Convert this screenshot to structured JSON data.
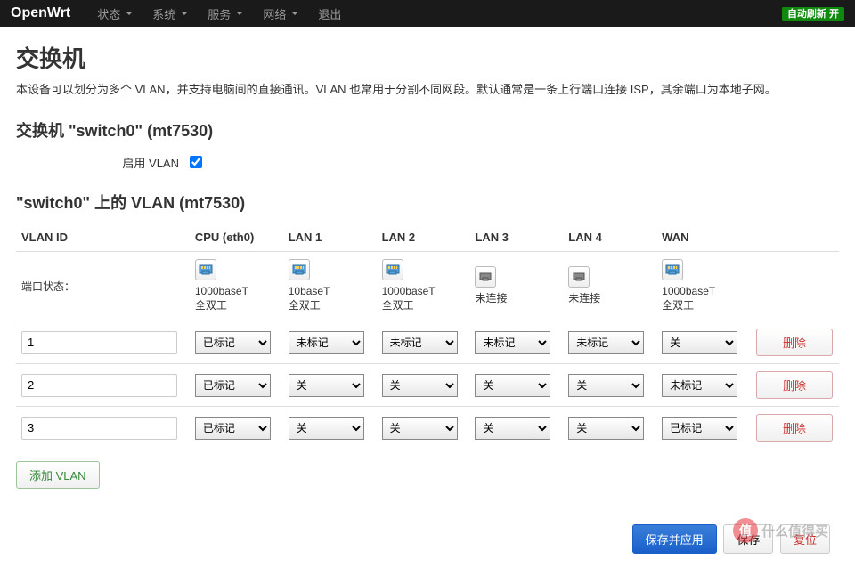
{
  "navbar": {
    "brand": "OpenWrt",
    "items": [
      {
        "label": "状态",
        "caret": true
      },
      {
        "label": "系统",
        "caret": true
      },
      {
        "label": "服务",
        "caret": true
      },
      {
        "label": "网络",
        "caret": true
      },
      {
        "label": "退出",
        "caret": false
      }
    ],
    "auto_refresh": "自动刷新 开"
  },
  "page": {
    "title": "交换机",
    "description": "本设备可以划分为多个 VLAN，并支持电脑间的直接通讯。VLAN 也常用于分割不同网段。默认通常是一条上行端口连接 ISP，其余端口为本地子网。"
  },
  "switch_section": {
    "title": "交换机 \"switch0\" (mt7530)",
    "enable_vlan_label": "启用 VLAN",
    "enable_vlan_checked": true
  },
  "vlan_section": {
    "title": "\"switch0\" 上的 VLAN (mt7530)",
    "headers": [
      "VLAN ID",
      "CPU (eth0)",
      "LAN 1",
      "LAN 2",
      "LAN 3",
      "LAN 4",
      "WAN"
    ],
    "port_status_label": "端口状态：",
    "ports": [
      {
        "connected": true,
        "speed": "1000baseT",
        "duplex": "全双工"
      },
      {
        "connected": true,
        "speed": "10baseT",
        "duplex": "全双工"
      },
      {
        "connected": true,
        "speed": "1000baseT",
        "duplex": "全双工"
      },
      {
        "connected": false,
        "status": "未连接"
      },
      {
        "connected": false,
        "status": "未连接"
      },
      {
        "connected": true,
        "speed": "1000baseT",
        "duplex": "全双工"
      }
    ],
    "rows": [
      {
        "id": "1",
        "values": [
          "已标记",
          "未标记",
          "未标记",
          "未标记",
          "未标记",
          "关"
        ]
      },
      {
        "id": "2",
        "values": [
          "已标记",
          "关",
          "关",
          "关",
          "关",
          "未标记"
        ]
      },
      {
        "id": "3",
        "values": [
          "已标记",
          "关",
          "关",
          "关",
          "关",
          "已标记"
        ]
      }
    ],
    "delete_label": "删除",
    "add_label": "添加 VLAN"
  },
  "actions": {
    "save_apply": "保存并应用",
    "save": "保存",
    "reset": "复位"
  },
  "watermark": {
    "circle": "值",
    "text": "什么值得买"
  }
}
